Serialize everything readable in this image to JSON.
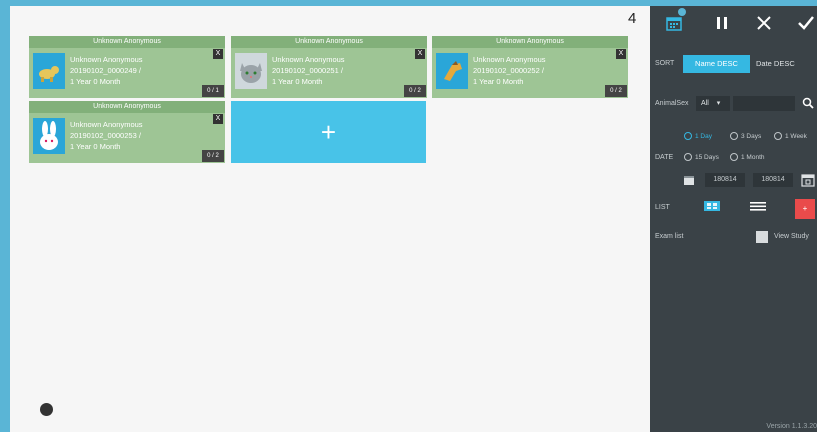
{
  "main": {
    "count": "4",
    "cards": [
      {
        "header": "Unknown Anonymous",
        "name": "Unknown Anonymous",
        "id": "20190102_0000249 /",
        "age": "1 Year 0 Month",
        "count": "0 / 1",
        "close": "X",
        "animal": "dog-icon"
      },
      {
        "header": "Unknown Anonymous",
        "name": "Unknown Anonymous",
        "id": "20190102_0000251 /",
        "age": "1 Year 0 Month",
        "count": "0 / 2",
        "close": "X",
        "animal": "cat-icon"
      },
      {
        "header": "Unknown Anonymous",
        "name": "Unknown Anonymous",
        "id": "20190102_0000252 /",
        "age": "1 Year 0 Month",
        "count": "0 / 2",
        "close": "X",
        "animal": "horse-icon"
      },
      {
        "header": "Unknown Anonymous",
        "name": "Unknown Anonymous",
        "id": "20190102_0000253 /",
        "age": "1 Year 0 Month",
        "count": "0 / 2",
        "close": "X",
        "animal": "rabbit-icon"
      }
    ],
    "add_label": "+"
  },
  "panel": {
    "sort_label": "SORT",
    "sort_options": [
      "Name DESC",
      "Date DESC"
    ],
    "animal_label": "AnimalSex",
    "animal_value": "All",
    "animal_caret": "▾",
    "search_placeholder": "",
    "date_label": "DATE",
    "radio_1day": "1 Day",
    "radio_3days": "3 Days",
    "radio_1week": "1 Week",
    "radio_15days": "15 Days",
    "radio_1month": "1 Month",
    "date_from": "180814",
    "date_to": "180814",
    "list_label": "LIST",
    "exam_list_label": "Exam list",
    "view_study_label": "View Study",
    "red_button": "+",
    "version": "Version 1.1.3.20"
  },
  "colors": {
    "accent": "#35b8e2",
    "card": "#9ec595",
    "panel": "#3a4247",
    "danger": "#e94b4b"
  }
}
